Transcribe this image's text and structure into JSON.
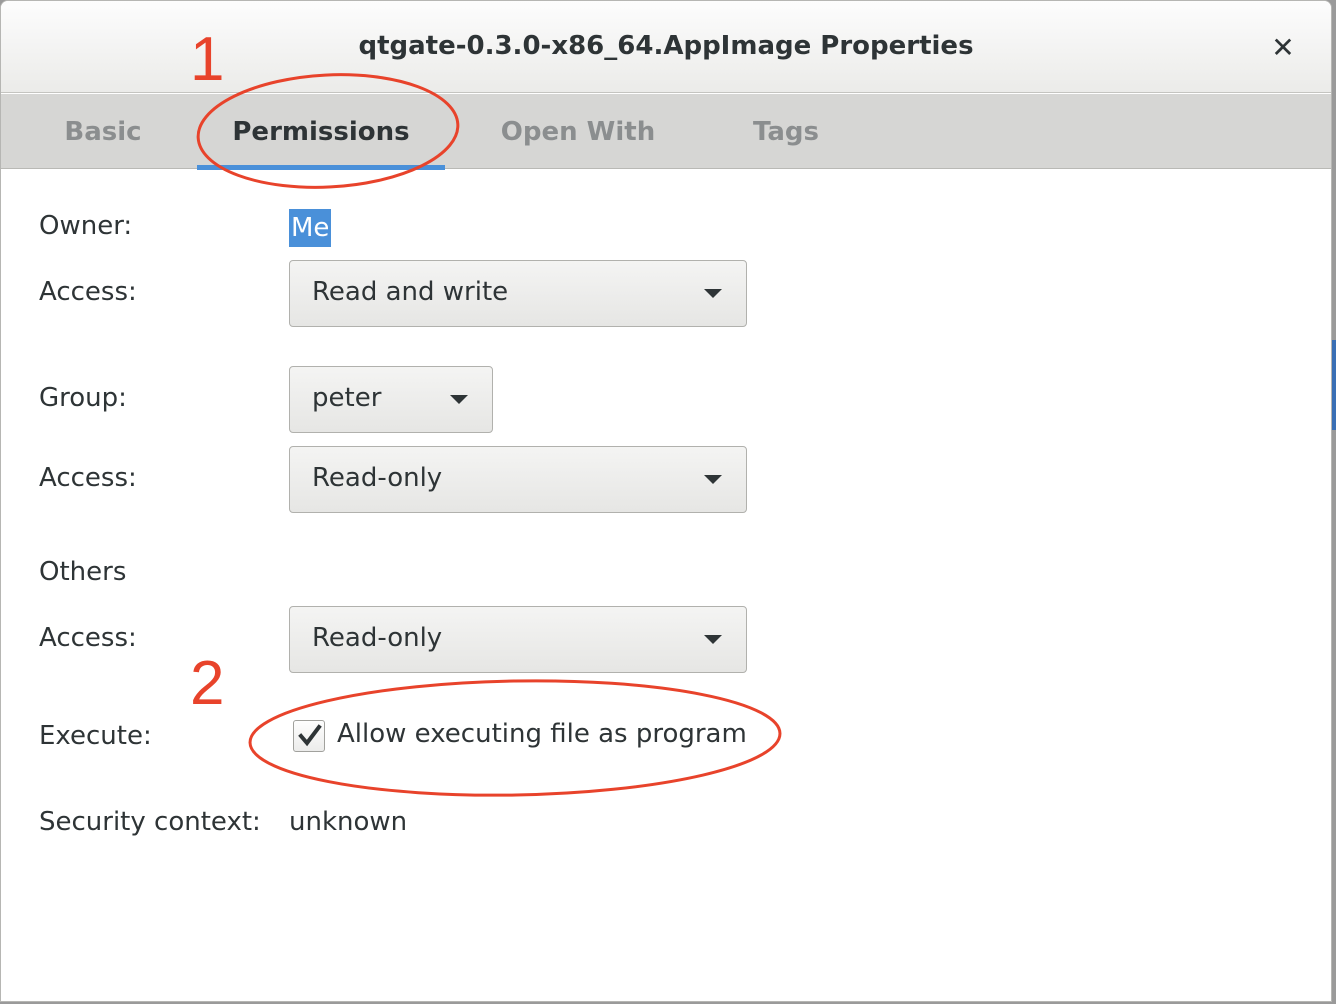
{
  "window": {
    "title": "qtgate-0.3.0-x86_64.AppImage Properties"
  },
  "tabs": [
    {
      "label": "Basic",
      "active": false
    },
    {
      "label": "Permissions",
      "active": true
    },
    {
      "label": "Open With",
      "active": false
    },
    {
      "label": "Tags",
      "active": false
    }
  ],
  "owner": {
    "label": "Owner:",
    "value": "Me",
    "access_label": "Access:",
    "access_value": "Read and write"
  },
  "group": {
    "label": "Group:",
    "value": "peter",
    "access_label": "Access:",
    "access_value": "Read-only"
  },
  "others": {
    "label": "Others",
    "access_label": "Access:",
    "access_value": "Read-only"
  },
  "execute": {
    "label": "Execute:",
    "checkbox_label": "Allow executing file as program",
    "checked": true
  },
  "security": {
    "label": "Security context:",
    "value": "unknown"
  },
  "annotations": {
    "step1": "1",
    "step2": "2",
    "color": "#e8432b"
  },
  "colors": {
    "accent": "#4a90d9",
    "text": "#2e3436",
    "inactive_tab_text": "#8b8e8f"
  }
}
